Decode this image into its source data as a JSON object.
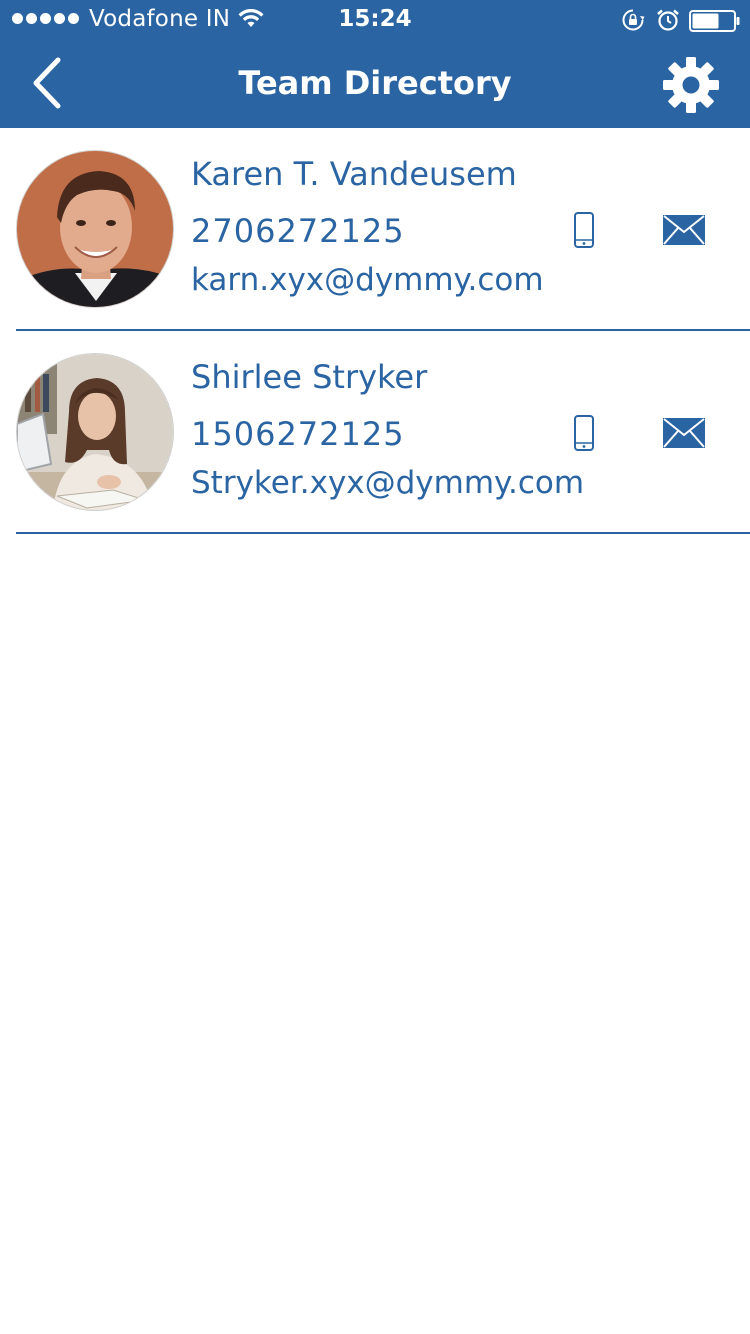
{
  "status_bar": {
    "carrier": "Vodafone IN",
    "time": "15:24",
    "battery_level": 0.65
  },
  "nav": {
    "title": "Team Directory",
    "back_icon": "chevron-left-icon",
    "settings_icon": "gear-icon"
  },
  "contacts": [
    {
      "name": "Karen T. Vandeusem",
      "phone": "2706272125",
      "email": "karn.xyx@dymmy.com",
      "avatar": "man-portrait"
    },
    {
      "name": "Shirlee Stryker",
      "phone": "1506272125",
      "email": "Stryker.xyx@dymmy.com",
      "avatar": "woman-reading-portrait"
    }
  ],
  "colors": {
    "brand_blue": "#2a64a2",
    "background": "#ffffff"
  }
}
